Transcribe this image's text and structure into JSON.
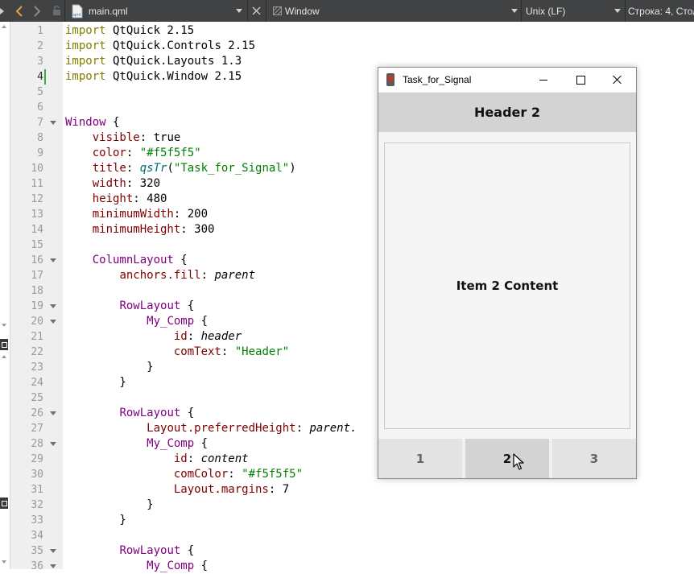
{
  "toolbar": {
    "file_name": "main.qml",
    "file_icon_label": "qml",
    "symbol_selector": "Window",
    "line_endings": "Unix (LF)",
    "cursor_position": "Строка: 4, Стол"
  },
  "editor": {
    "line_numbers": [
      "1",
      "2",
      "3",
      "4",
      "5",
      "6",
      "7",
      "8",
      "9",
      "10",
      "11",
      "12",
      "13",
      "14",
      "15",
      "16",
      "17",
      "18",
      "19",
      "20",
      "21",
      "22",
      "23",
      "24",
      "25",
      "26",
      "27",
      "28",
      "29",
      "30",
      "31",
      "32",
      "33",
      "34",
      "35",
      "36"
    ],
    "current_line": "4",
    "lines": [
      [
        {
          "t": "import",
          "c": "kw"
        },
        {
          "t": " QtQuick 2.15",
          "c": "pl"
        }
      ],
      [
        {
          "t": "import",
          "c": "kw"
        },
        {
          "t": " QtQuick.Controls 2.15",
          "c": "pl"
        }
      ],
      [
        {
          "t": "import",
          "c": "kw"
        },
        {
          "t": " QtQuick.Layouts 1.3",
          "c": "pl"
        }
      ],
      [
        {
          "t": "import",
          "c": "kw"
        },
        {
          "t": " QtQuick.Window 2.15",
          "c": "pl"
        }
      ],
      [],
      [],
      [
        {
          "t": "Window",
          "c": "ty"
        },
        {
          "t": " {",
          "c": "pl"
        }
      ],
      [
        {
          "t": "    ",
          "c": "pl"
        },
        {
          "t": "visible",
          "c": "pr"
        },
        {
          "t": ": true",
          "c": "pl"
        }
      ],
      [
        {
          "t": "    ",
          "c": "pl"
        },
        {
          "t": "color",
          "c": "pr"
        },
        {
          "t": ": ",
          "c": "pl"
        },
        {
          "t": "\"#f5f5f5\"",
          "c": "st"
        }
      ],
      [
        {
          "t": "    ",
          "c": "pl"
        },
        {
          "t": "title",
          "c": "pr"
        },
        {
          "t": ": ",
          "c": "pl"
        },
        {
          "t": "qsTr",
          "c": "fn"
        },
        {
          "t": "(",
          "c": "pl"
        },
        {
          "t": "\"Task_for_Signal\"",
          "c": "st"
        },
        {
          "t": ")",
          "c": "pl"
        }
      ],
      [
        {
          "t": "    ",
          "c": "pl"
        },
        {
          "t": "width",
          "c": "pr"
        },
        {
          "t": ": 320",
          "c": "pl"
        }
      ],
      [
        {
          "t": "    ",
          "c": "pl"
        },
        {
          "t": "height",
          "c": "pr"
        },
        {
          "t": ": 480",
          "c": "pl"
        }
      ],
      [
        {
          "t": "    ",
          "c": "pl"
        },
        {
          "t": "minimumWidth",
          "c": "pr"
        },
        {
          "t": ": 200",
          "c": "pl"
        }
      ],
      [
        {
          "t": "    ",
          "c": "pl"
        },
        {
          "t": "minimumHeight",
          "c": "pr"
        },
        {
          "t": ": 300",
          "c": "pl"
        }
      ],
      [],
      [
        {
          "t": "    ",
          "c": "pl"
        },
        {
          "t": "ColumnLayout",
          "c": "ty"
        },
        {
          "t": " {",
          "c": "pl"
        }
      ],
      [
        {
          "t": "        ",
          "c": "pl"
        },
        {
          "t": "anchors.fill",
          "c": "pr"
        },
        {
          "t": ": ",
          "c": "pl"
        },
        {
          "t": "parent",
          "c": "it"
        }
      ],
      [],
      [
        {
          "t": "        ",
          "c": "pl"
        },
        {
          "t": "RowLayout",
          "c": "ty"
        },
        {
          "t": " {",
          "c": "pl"
        }
      ],
      [
        {
          "t": "            ",
          "c": "pl"
        },
        {
          "t": "My_Comp",
          "c": "ty"
        },
        {
          "t": " {",
          "c": "pl"
        }
      ],
      [
        {
          "t": "                ",
          "c": "pl"
        },
        {
          "t": "id",
          "c": "pr"
        },
        {
          "t": ": ",
          "c": "pl"
        },
        {
          "t": "header",
          "c": "it"
        }
      ],
      [
        {
          "t": "                ",
          "c": "pl"
        },
        {
          "t": "comText",
          "c": "pr"
        },
        {
          "t": ": ",
          "c": "pl"
        },
        {
          "t": "\"Header\"",
          "c": "st"
        }
      ],
      [
        {
          "t": "            }",
          "c": "pl"
        }
      ],
      [
        {
          "t": "        }",
          "c": "pl"
        }
      ],
      [],
      [
        {
          "t": "        ",
          "c": "pl"
        },
        {
          "t": "RowLayout",
          "c": "ty"
        },
        {
          "t": " {",
          "c": "pl"
        }
      ],
      [
        {
          "t": "            ",
          "c": "pl"
        },
        {
          "t": "Layout.preferredHeight",
          "c": "pr"
        },
        {
          "t": ": ",
          "c": "pl"
        },
        {
          "t": "parent.",
          "c": "it"
        }
      ],
      [
        {
          "t": "            ",
          "c": "pl"
        },
        {
          "t": "My_Comp",
          "c": "ty"
        },
        {
          "t": " {",
          "c": "pl"
        }
      ],
      [
        {
          "t": "                ",
          "c": "pl"
        },
        {
          "t": "id",
          "c": "pr"
        },
        {
          "t": ": ",
          "c": "pl"
        },
        {
          "t": "content",
          "c": "it"
        }
      ],
      [
        {
          "t": "                ",
          "c": "pl"
        },
        {
          "t": "comColor",
          "c": "pr"
        },
        {
          "t": ": ",
          "c": "pl"
        },
        {
          "t": "\"#f5f5f5\"",
          "c": "st"
        }
      ],
      [
        {
          "t": "                ",
          "c": "pl"
        },
        {
          "t": "Layout.margins",
          "c": "pr"
        },
        {
          "t": ": 7",
          "c": "pl"
        }
      ],
      [
        {
          "t": "            }",
          "c": "pl"
        }
      ],
      [
        {
          "t": "        }",
          "c": "pl"
        }
      ],
      [],
      [
        {
          "t": "        ",
          "c": "pl"
        },
        {
          "t": "RowLayout",
          "c": "ty"
        },
        {
          "t": " {",
          "c": "pl"
        }
      ],
      [
        {
          "t": "            ",
          "c": "pl"
        },
        {
          "t": "My_Comp",
          "c": "ty"
        },
        {
          "t": " {",
          "c": "pl"
        }
      ]
    ],
    "fold_lines": [
      "7",
      "16",
      "19",
      "20",
      "26",
      "28",
      "35",
      "36"
    ]
  },
  "app_window": {
    "title": "Task_for_Signal",
    "header_text": "Header 2",
    "content_text": "Item 2 Content",
    "tabs": [
      "1",
      "2",
      "3"
    ],
    "active_tab": "2"
  },
  "colors": {
    "toolbar_bg": "#404244",
    "keyword": "#808000",
    "type": "#800080",
    "property": "#800000",
    "string": "#008000",
    "function": "#00677c",
    "window_bg": "#f5f5f5",
    "header_bg": "#d3d3d3"
  }
}
